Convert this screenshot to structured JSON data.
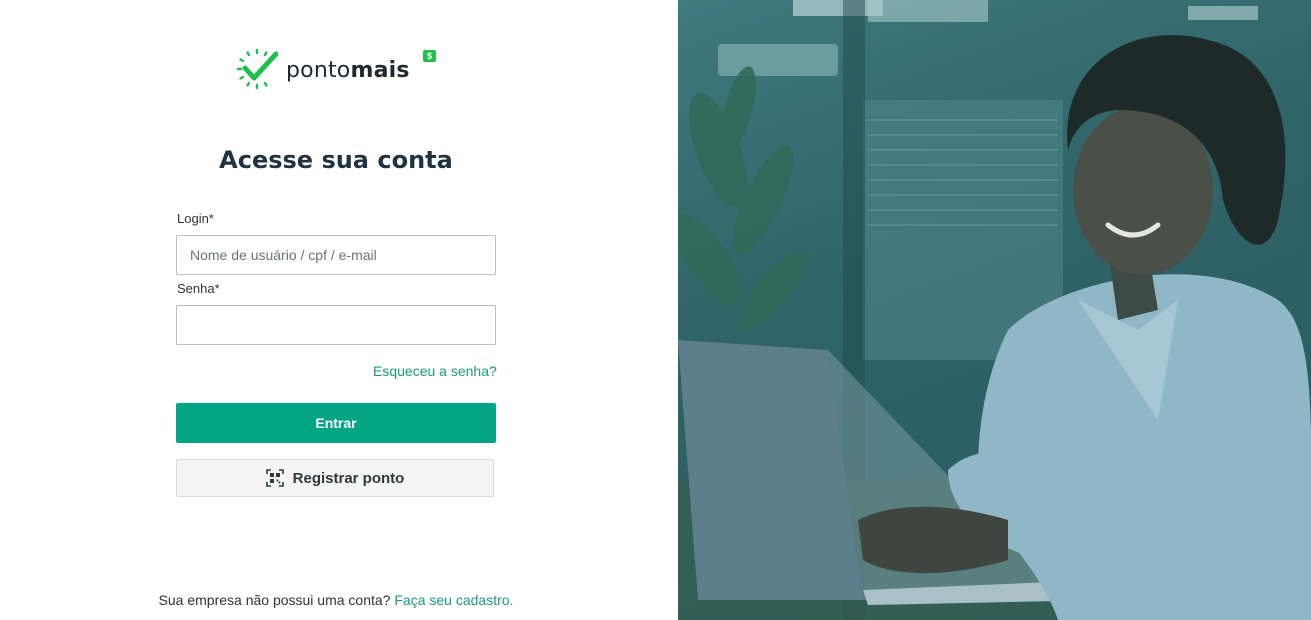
{
  "brand": {
    "name_regular": "ponto",
    "name_bold": "mais",
    "badge": "$",
    "accent_color": "#04a585",
    "logo_green": "#1fbf4f"
  },
  "login_form": {
    "title": "Acesse sua conta",
    "login_label": "Login*",
    "login_placeholder": "Nome de usuário / cpf / e-mail",
    "login_value": "",
    "password_label": "Senha*",
    "password_value": "",
    "forgot_password": "Esqueceu a senha?",
    "submit_label": "Entrar",
    "register_punch_label": "Registrar ponto",
    "register_punch_icon": "qr-scan-icon"
  },
  "footer": {
    "question": "Sua empresa não possui uma conta?",
    "signup_link": "Faça seu cadastro."
  }
}
